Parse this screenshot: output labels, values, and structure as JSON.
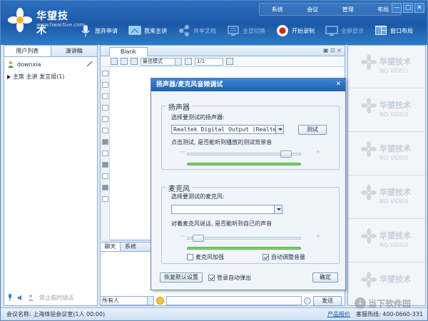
{
  "app": {
    "logo_name": "华望技术",
    "logo_url": "www.hwactive.com"
  },
  "top_menu": [
    "系统",
    "会议",
    "管理",
    "布局"
  ],
  "window_controls": [
    "—",
    "□",
    "✕"
  ],
  "toolbar": [
    {
      "label": "放弃申请",
      "icon": "microphone-icon",
      "state": "on"
    },
    {
      "label": "我来主讲",
      "icon": "presenter-icon",
      "state": "on"
    },
    {
      "label": "共享文档",
      "icon": "share-document-icon",
      "state": "dim"
    },
    {
      "label": "主显切换",
      "icon": "display-switch-icon",
      "state": "dim"
    },
    {
      "label": "开始录制",
      "icon": "record-icon",
      "state": "on"
    },
    {
      "label": "全屏显示",
      "icon": "fullscreen-icon",
      "state": "dim"
    },
    {
      "label": "窗口布局",
      "icon": "window-layout-icon",
      "state": "on"
    }
  ],
  "left_panel": {
    "tabs": [
      "用户列表",
      "演讲稿"
    ],
    "user": "downxia",
    "group": "主席 主讲 发言组(1)",
    "bottom_label": "禁止临时插话"
  },
  "board": {
    "tab": "Blank",
    "zoom_mode": "最佳模式",
    "page": "1/1"
  },
  "video": {
    "brand": "华望技术",
    "no_video": "NO VIDEO"
  },
  "chat": {
    "tabs": [
      "聊天",
      "系统"
    ],
    "recipient": "所有人",
    "send_label": "发送"
  },
  "status": {
    "meeting": "会议名称: 上海体验会议室(1人 00:00)",
    "link": "产品报价",
    "hotline": "客服热线: 400-0660-331"
  },
  "watermark": "当下软件园",
  "dialog": {
    "title": "扬声器/麦克风音频调试",
    "speaker": {
      "title": "扬声器",
      "select_label": "选择要测试的扬声器:",
      "device": "Realtek Digital Output (Realtek",
      "test_button": "测试",
      "hint": "点击测试, 是否能听到播放的测试背景音",
      "volume": 0.9,
      "level": 1.0
    },
    "mic": {
      "title": "麦克风",
      "select_label": "选择要测试的麦克风:",
      "device": "",
      "hint": "对着麦克风说话, 是否能听到自己的声音",
      "volume": 0.05,
      "level": 1.0,
      "boost_label": "麦克风加强",
      "boost": false,
      "auto_label": "自动调整音量",
      "auto": true
    },
    "restore_label": "恢复默认设置",
    "auto_popup_label": "登录自动弹出",
    "auto_popup": true,
    "ok_label": "确定"
  },
  "colors": {
    "header": "#1c5aa8",
    "accent": "#3d85d6",
    "meter": "#7bd26a"
  }
}
